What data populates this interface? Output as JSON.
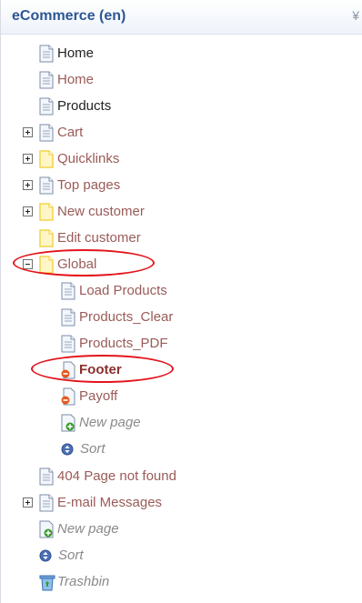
{
  "header": {
    "title": "eCommerce (en)",
    "collapse_glyph": "¥"
  },
  "tree": {
    "items": [
      {
        "label": "Home",
        "icon": "page-icon",
        "style": "dark"
      },
      {
        "label": "Home",
        "icon": "page-icon",
        "style": "link"
      },
      {
        "label": "Products",
        "icon": "page-icon",
        "style": "dark"
      },
      {
        "label": "Cart",
        "icon": "page-icon",
        "style": "link",
        "toggle": "expand"
      },
      {
        "label": "Quicklinks",
        "icon": "folder-page-icon",
        "style": "link",
        "toggle": "expand"
      },
      {
        "label": "Top pages",
        "icon": "page-icon",
        "style": "link",
        "toggle": "expand"
      },
      {
        "label": "New customer",
        "icon": "folder-page-icon",
        "style": "link",
        "toggle": "expand"
      },
      {
        "label": "Edit customer",
        "icon": "folder-page-icon",
        "style": "link"
      },
      {
        "label": "Global",
        "icon": "folder-page-icon",
        "style": "link",
        "toggle": "collapse"
      },
      {
        "label": "Load Products",
        "icon": "page-icon",
        "style": "link"
      },
      {
        "label": "Products_Clear",
        "icon": "page-icon",
        "style": "link"
      },
      {
        "label": "Products_PDF",
        "icon": "page-icon",
        "style": "link"
      },
      {
        "label": "Footer",
        "icon": "error-page-icon",
        "style": "bold"
      },
      {
        "label": "Payoff",
        "icon": "error-page-icon",
        "style": "link"
      },
      {
        "label": "New page",
        "icon": "new-page-icon",
        "style": "grey"
      },
      {
        "label": "Sort",
        "icon": "sort-icon",
        "style": "grey"
      },
      {
        "label": "404 Page not found",
        "icon": "page-icon",
        "style": "link"
      },
      {
        "label": "E-mail Messages",
        "icon": "page-icon",
        "style": "link",
        "toggle": "expand"
      },
      {
        "label": "New page",
        "icon": "new-page-icon",
        "style": "grey"
      },
      {
        "label": "Sort",
        "icon": "sort-icon",
        "style": "grey"
      },
      {
        "label": "Trashbin",
        "icon": "trashbin-icon",
        "style": "grey"
      }
    ]
  },
  "colors": {
    "title": "#2c5794",
    "link_text": "#9a5b58",
    "highlight_ellipse": "#e3141b",
    "folder_yellow": "#f4d44a",
    "page_blue": "#6f8fc3"
  }
}
